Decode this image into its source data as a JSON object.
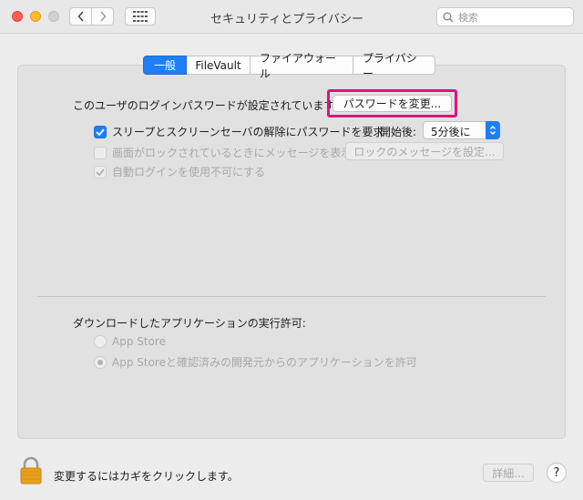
{
  "window": {
    "title": "セキュリティとプライバシー",
    "search_placeholder": "検索"
  },
  "tabs": [
    {
      "label": "一般",
      "active": true
    },
    {
      "label": "FileVault",
      "active": false
    },
    {
      "label": "ファイアウォール",
      "active": false
    },
    {
      "label": "プライバシー",
      "active": false
    }
  ],
  "general": {
    "password_label": "このユーザのログインパスワードが設定されています",
    "change_password_button": "パスワードを変更...",
    "require_password": {
      "label": "スリープとスクリーンセーバの解除にパスワードを要求",
      "checked": true
    },
    "start_label": "開始後:",
    "start_select_value": "5分後に",
    "show_message": {
      "label": "画面がロックされているときにメッセージを表示",
      "checked": false,
      "enabled": false
    },
    "set_message_button": "ロックのメッセージを設定...",
    "disable_autologin": {
      "label": "自動ログインを使用不可にする",
      "checked": true,
      "enabled": false
    }
  },
  "downloads": {
    "label": "ダウンロードしたアプリケーションの実行許可:",
    "options": [
      {
        "label": "App Store",
        "selected": false
      },
      {
        "label": "App Storeと確認済みの開発元からのアプリケーションを許可",
        "selected": true
      }
    ]
  },
  "footer": {
    "lock_text": "変更するにはカギをクリックします。",
    "advanced_button": "詳細...",
    "help_button": "?"
  },
  "colors": {
    "accent": "#1f7ef6",
    "highlight": "#e0137b",
    "lock": "#e8a019"
  }
}
